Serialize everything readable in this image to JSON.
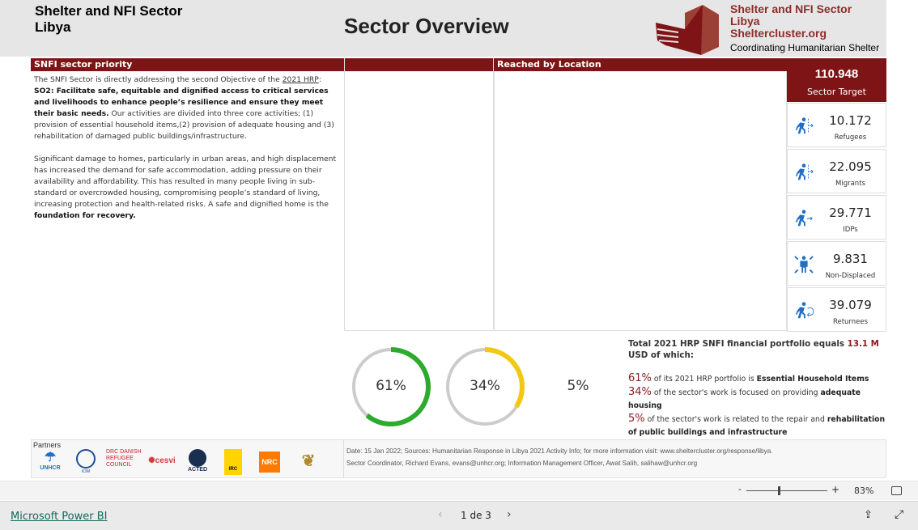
{
  "header": {
    "left_title_line1": "Shelter and NFI Sector",
    "left_title_line2": "Libya",
    "title": "Sector Overview",
    "org_line1": "Shelter and NFI Sector",
    "org_line2": "Libya",
    "org_line3": "Sheltercluster.org",
    "org_tagline": "Coordinating Humanitarian Shelter"
  },
  "priority": {
    "heading": "SNFI sector priority",
    "p1_a": "The SNFI Sector is directly addressing the second Objective of the ",
    "p1_link": "2021 HRP",
    "p1_b": ":  ",
    "p1_bold": "SO2: Facilitate safe, equitable and dignified access to critical services and livelihoods to enhance people’s resilience and ensure they meet their basic needs.",
    "p1_c": "  Our activities are divided into three core activities; (1) provision of essential household items,(2) provision of adequate housing and (3) rehabilitation of damaged public buildings/infrastructure.",
    "p2_a": "Significant damage to homes, particularly in urban areas, and high displacement has increased the demand for safe accommodation, adding pressure on their availability and affordability. This has resulted in many people living in sub-standard or overcrowded housing, compromising people’s standard of living, increasing protection and health-related risks.  A safe and dignified home is the ",
    "p2_bold": "foundation for recovery."
  },
  "reached": {
    "heading": "Reached by Location"
  },
  "target": {
    "value": "110.948",
    "label": "Sector Target"
  },
  "kpis": [
    {
      "value": "10.172",
      "label": "Refugees",
      "icon": "refugee-icon"
    },
    {
      "value": "22.095",
      "label": "Migrants",
      "icon": "migrant-icon"
    },
    {
      "value": "29.771",
      "label": "IDPs",
      "icon": "idp-icon"
    },
    {
      "value": "9.831",
      "label": "Non-Displaced",
      "icon": "non-displaced-icon"
    },
    {
      "value": "39.079",
      "label": "Returnees",
      "icon": "returnee-icon"
    }
  ],
  "donuts": [
    {
      "label": "61%",
      "value": 61,
      "color": "#2eaa2e"
    },
    {
      "label": "34%",
      "value": 34,
      "color": "#f2c811"
    },
    {
      "label": "5%",
      "value": 5,
      "color": "#ffffff"
    }
  ],
  "finance": {
    "intro_a": "Total 2021 HRP SNFI financial portfolio equals ",
    "amount": "13.1 M",
    "intro_b": " USD of which:",
    "items": [
      {
        "pct": "61%",
        "text": " of its 2021 HRP portfolio is ",
        "bold": "Essential Household Items"
      },
      {
        "pct": "34%",
        "text": " of the sector's work is focused on providing ",
        "bold": "adequate housing"
      },
      {
        "pct": "5%",
        "text": " of the sector's work is related to the repair and ",
        "bold": "rehabilitation of public buildings and infrastructure"
      }
    ]
  },
  "footer": {
    "partners_label": "Partners",
    "partners": [
      "UNHCR",
      "IOM",
      "DRC DANISH REFUGEE COUNCIL",
      "CESVI",
      "ACTED",
      "IRC",
      "NRC",
      "Partner"
    ],
    "line1": "Date: 15 Jan 2022; Sources: Humanitarian Response in Libya 2021 Activity Info; for more information visit: www.sheltercluster.org/response/libya.",
    "line2": "Sector Coordinator, Richard Evans, evans@unhcr.org; Information Management Officer, Awat Salih, salihaw@unhcr.org"
  },
  "viewer": {
    "zoom": "83%",
    "zoom_minus": "-",
    "zoom_plus": "+",
    "zoom_fraction": 0.4,
    "brand": "Microsoft Power BI",
    "page": "1 de 3"
  },
  "colors": {
    "accent": "#7f1416",
    "icon_blue": "#1f6fc5"
  }
}
